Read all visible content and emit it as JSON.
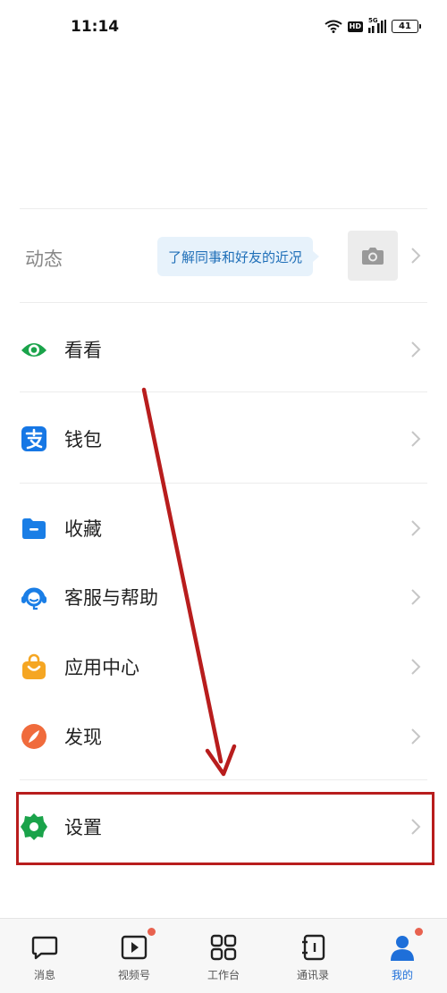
{
  "status_bar": {
    "time": "11:14",
    "hd_label": "HD",
    "network_label": "5G",
    "battery_level": "41"
  },
  "moments": {
    "label": "动态",
    "bubble_text": "了解同事和好友的近况"
  },
  "menu": {
    "items": [
      {
        "label": "看看",
        "icon": "eye-icon",
        "color": "#1aa34a"
      },
      {
        "label": "钱包",
        "icon": "wallet-icon",
        "color": "#1677e5"
      },
      {
        "label": "收藏",
        "icon": "folder-icon",
        "color": "#1a7ee6"
      },
      {
        "label": "客服与帮助",
        "icon": "headset-icon",
        "color": "#1a7ee6"
      },
      {
        "label": "应用中心",
        "icon": "shopping-bag-icon",
        "color": "#f5a623"
      },
      {
        "label": "发现",
        "icon": "compass-icon",
        "color": "#f06b3c"
      },
      {
        "label": "设置",
        "icon": "gear-icon",
        "color": "#1aa34a"
      }
    ]
  },
  "tab_bar": {
    "tabs": [
      {
        "label": "消息",
        "icon": "chat-bubble-icon",
        "badge": false
      },
      {
        "label": "视频号",
        "icon": "video-icon",
        "badge": true
      },
      {
        "label": "工作台",
        "icon": "grid-icon",
        "badge": false
      },
      {
        "label": "通讯录",
        "icon": "contacts-book-icon",
        "badge": false
      },
      {
        "label": "我的",
        "icon": "person-icon",
        "badge": true,
        "active": true
      }
    ]
  },
  "colors": {
    "accent": "#1e6fd9",
    "highlight": "#b81d1d",
    "badge": "#e8624f"
  }
}
